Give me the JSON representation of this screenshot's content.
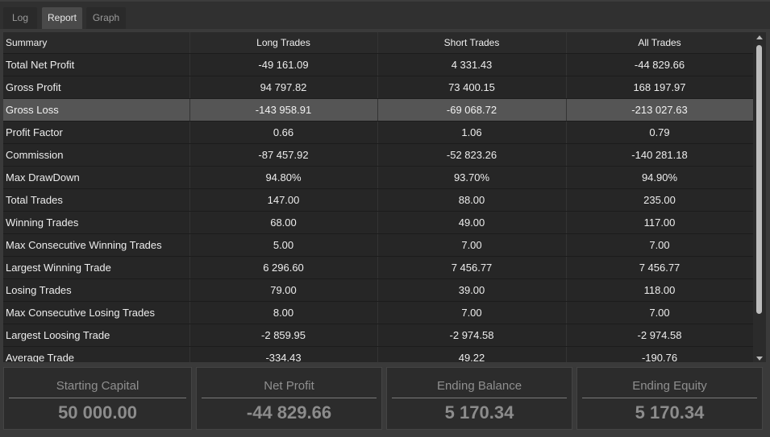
{
  "tabs": [
    {
      "label": "Log"
    },
    {
      "label": "Report"
    },
    {
      "label": "Graph"
    }
  ],
  "table": {
    "headers": [
      "Summary",
      "Long Trades",
      "Short Trades",
      "All Trades"
    ],
    "selected_row": "Gross Loss",
    "rows": [
      {
        "label": "Total Net Profit",
        "long": "-49 161.09",
        "short": "4 331.43",
        "all": "-44 829.66"
      },
      {
        "label": "Gross Profit",
        "long": "94 797.82",
        "short": "73 400.15",
        "all": "168 197.97"
      },
      {
        "label": "Gross Loss",
        "long": "-143 958.91",
        "short": "-69 068.72",
        "all": "-213 027.63"
      },
      {
        "label": "Profit Factor",
        "long": "0.66",
        "short": "1.06",
        "all": "0.79"
      },
      {
        "label": "Commission",
        "long": "-87 457.92",
        "short": "-52 823.26",
        "all": "-140 281.18"
      },
      {
        "label": "Max DrawDown",
        "long": "94.80%",
        "short": "93.70%",
        "all": "94.90%"
      },
      {
        "label": "Total Trades",
        "long": "147.00",
        "short": "88.00",
        "all": "235.00"
      },
      {
        "label": "Winning Trades",
        "long": "68.00",
        "short": "49.00",
        "all": "117.00"
      },
      {
        "label": "Max Consecutive Winning Trades",
        "long": "5.00",
        "short": "7.00",
        "all": "7.00"
      },
      {
        "label": "Largest Winning Trade",
        "long": "6 296.60",
        "short": "7 456.77",
        "all": "7 456.77"
      },
      {
        "label": "Losing Trades",
        "long": "79.00",
        "short": "39.00",
        "all": "118.00"
      },
      {
        "label": "Max Consecutive Losing Trades",
        "long": "8.00",
        "short": "7.00",
        "all": "7.00"
      },
      {
        "label": "Largest Loosing Trade",
        "long": "-2 859.95",
        "short": "-2 974.58",
        "all": "-2 974.58"
      },
      {
        "label": "Average Trade",
        "long": "-334.43",
        "short": "49.22",
        "all": "-190.76"
      }
    ]
  },
  "summary_cards": [
    {
      "label": "Starting Capital",
      "value": "50 000.00"
    },
    {
      "label": "Net Profit",
      "value": "-44 829.66"
    },
    {
      "label": "Ending Balance",
      "value": "5 170.34"
    },
    {
      "label": "Ending Equity",
      "value": "5 170.34"
    }
  ],
  "colors": {
    "background": "#2f2f2f",
    "selected_row": "#555555",
    "grid": "#262626"
  }
}
